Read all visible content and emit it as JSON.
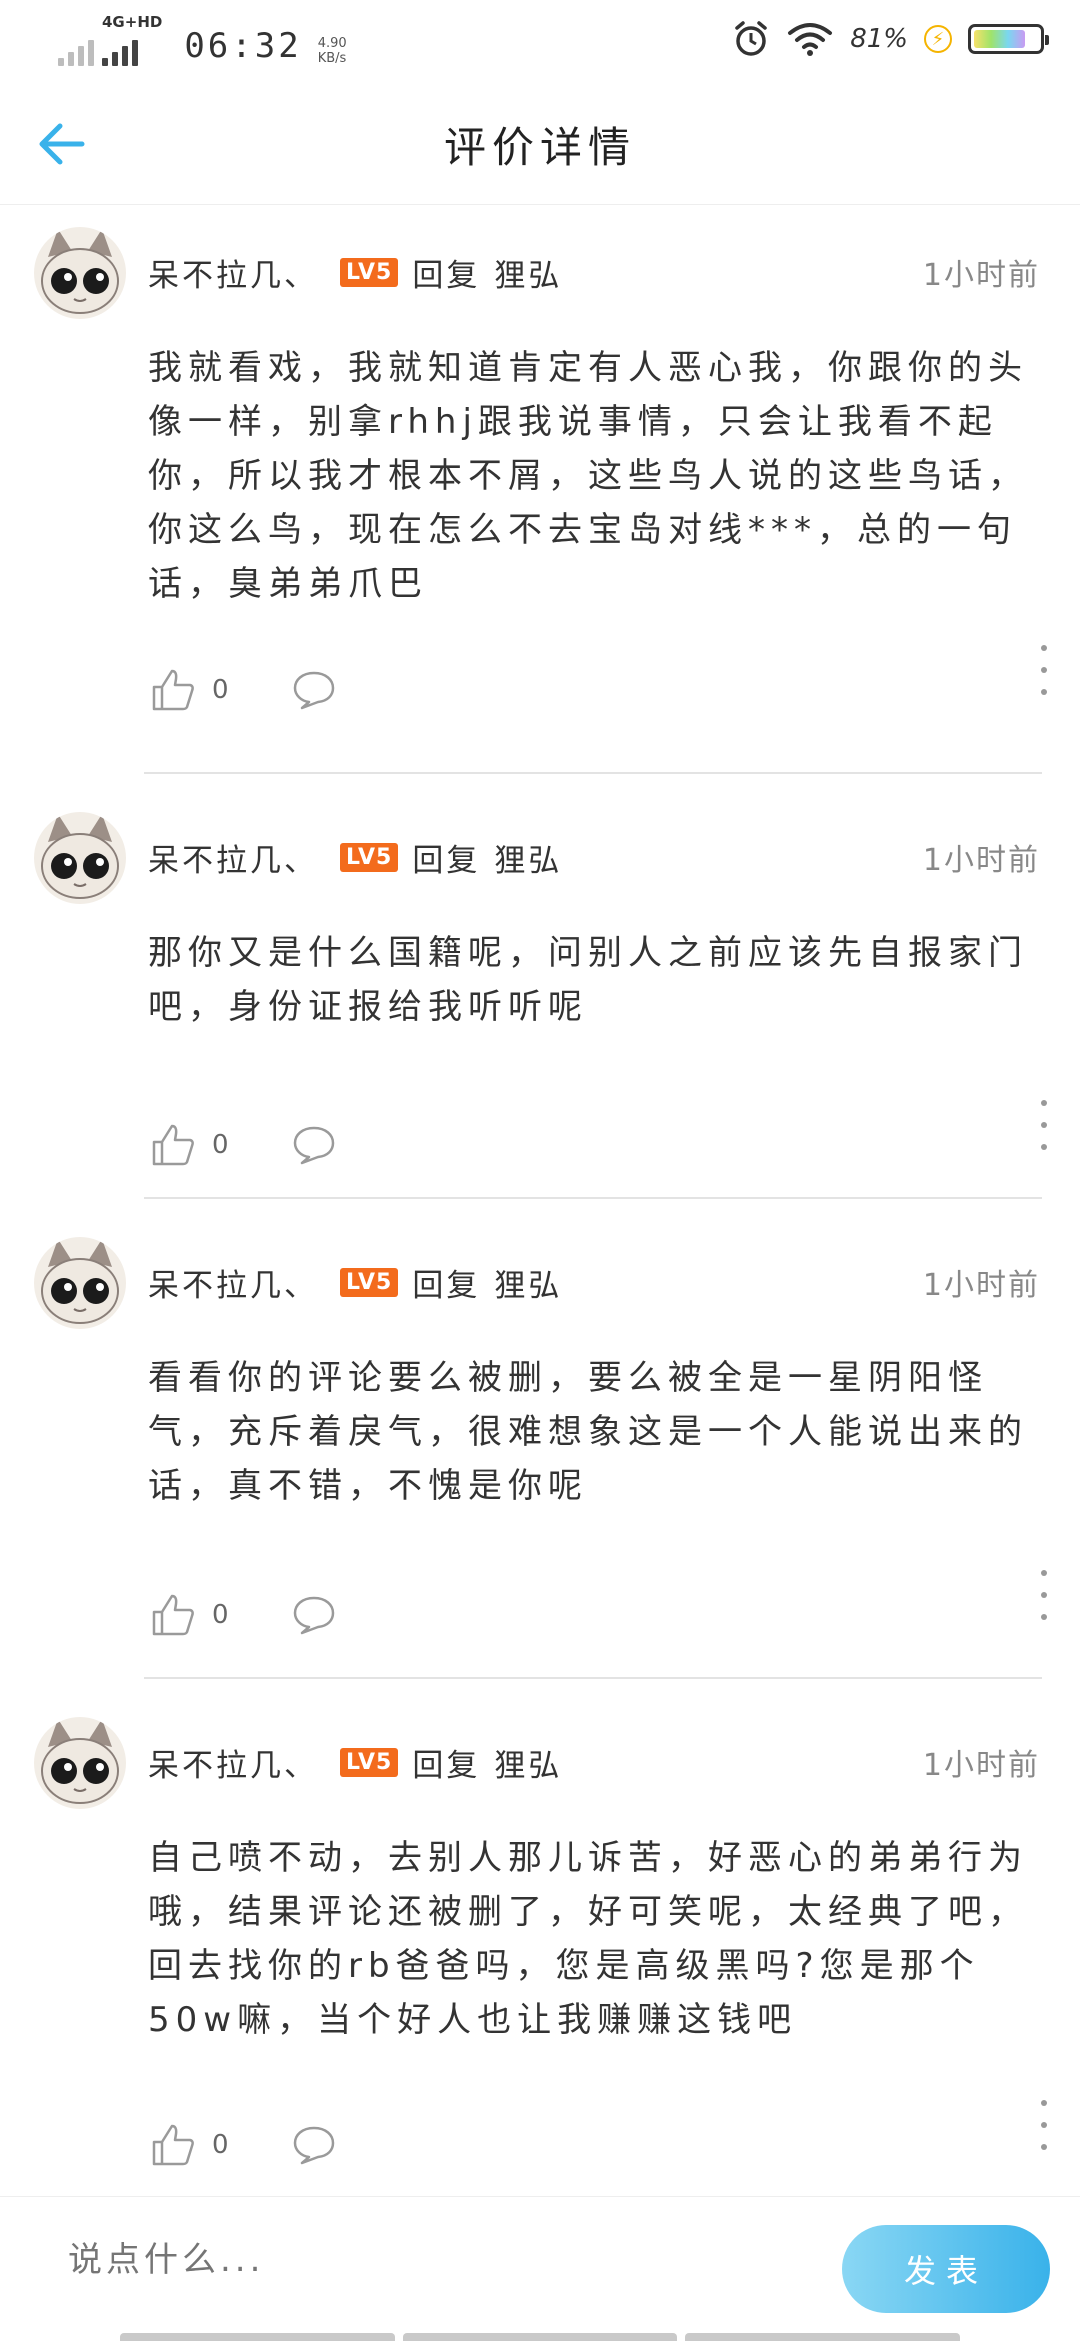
{
  "status_bar": {
    "network": "4G+HD",
    "time": "06:32",
    "speed_value": "4.90",
    "speed_unit": "KB/s",
    "battery_percent": "81%",
    "battery_level": 0.81
  },
  "header": {
    "title": "评价详情"
  },
  "comments": [
    {
      "user": "呆不拉几、",
      "level": "LV5",
      "reply_label": "回复",
      "reply_to": "狸弘",
      "time": "1小时前",
      "text": "我就看戏，我就知道肯定有人恶心我，你跟你的头像一样，别拿rhhj跟我说事情，只会让我看不起你，所以我才根本不屑，这些鸟人说的这些鸟话，你这么鸟，现在怎么不去宝岛对线***，总的一句话，臭弟弟爪巴",
      "likes": "0"
    },
    {
      "user": "呆不拉几、",
      "level": "LV5",
      "reply_label": "回复",
      "reply_to": "狸弘",
      "time": "1小时前",
      "text": "那你又是什么国籍呢，问别人之前应该先自报家门吧，身份证报给我听听呢",
      "likes": "0"
    },
    {
      "user": "呆不拉几、",
      "level": "LV5",
      "reply_label": "回复",
      "reply_to": "狸弘",
      "time": "1小时前",
      "text": "看看你的评论要么被删，要么被全是一星阴阳怪气，充斥着戾气，很难想象这是一个人能说出来的话，真不错，不愧是你呢",
      "likes": "0"
    },
    {
      "user": "呆不拉几、",
      "level": "LV5",
      "reply_label": "回复",
      "reply_to": "狸弘",
      "time": "1小时前",
      "text": "自己喷不动，去别人那儿诉苦，好恶心的弟弟行为哦，结果评论还被删了，好可笑呢，太经典了吧，回去找你的rb爸爸吗，您是高级黑吗?您是那个50w嘛，当个好人也让我赚赚这钱吧",
      "likes": "0"
    }
  ],
  "composer": {
    "placeholder": "说点什么...",
    "send_label": "发表"
  },
  "colors": {
    "accent": "#39b2ea",
    "level_badge": "#f36b1c"
  },
  "icons": [
    "back-arrow-icon",
    "like-icon",
    "comment-icon",
    "more-icon",
    "alarm-icon",
    "wifi-icon",
    "battery-icon"
  ]
}
